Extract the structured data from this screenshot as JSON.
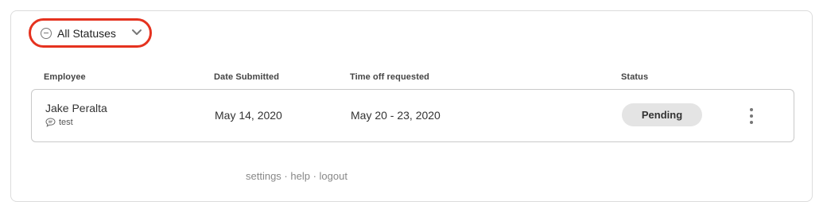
{
  "filter": {
    "selected": "All Statuses",
    "icon": "minus-circle-icon",
    "highlight_color": "#e5321f"
  },
  "table": {
    "columns": [
      "Employee",
      "Date Submitted",
      "Time off requested",
      "Status"
    ],
    "rows": [
      {
        "employee": "Jake Peralta",
        "comment": "test",
        "date_submitted": "May 14, 2020",
        "time_off": "May 20 - 23, 2020",
        "status": "Pending"
      }
    ]
  },
  "footer": {
    "links": [
      "settings",
      "help",
      "logout"
    ],
    "separator": " · "
  }
}
